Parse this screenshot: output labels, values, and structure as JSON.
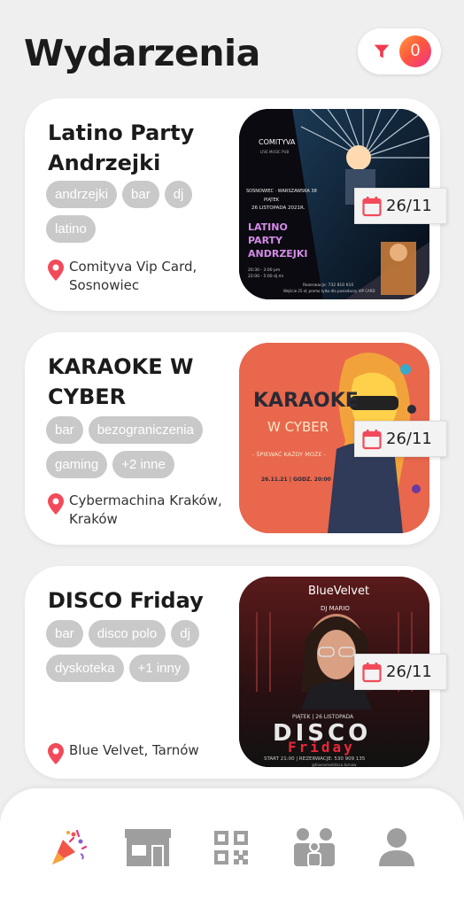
{
  "header": {
    "title": "Wydarzenia",
    "filter_icon": "filter-icon",
    "filter_count": "0"
  },
  "colors": {
    "accent": "#f24a5a",
    "tag_bg": "#c9c9c9",
    "nav_inactive": "#9e9e9e",
    "background": "#efefef"
  },
  "events": [
    {
      "title": "Latino Party Andrzejki",
      "tags": [
        "andrzejki",
        "bar",
        "dj",
        "latino"
      ],
      "location": "Comityva Vip Card, Sosnowiec",
      "date": "26/11",
      "poster": {
        "brand": "COMITYVA",
        "subbrand": "LIVE MUSIC PUB",
        "address": "SOSNOWIEC · WARSZAWSKA 38",
        "day": "PIĄTEK",
        "date_line": "26 LISTOPADA 2021R.",
        "title_lines": [
          "LATINO",
          "PARTY",
          "ANDRZEJKI"
        ],
        "time1": "20:30 - 3:00 pm",
        "time2": "22:00 - 5:00 dj mi",
        "footer1": "Rezerwacje: 732 810 610",
        "footer2": "Wejście 25 zł, promo tylko dla posiadaczy VIP CARD"
      }
    },
    {
      "title": "KARAOKE W CYBER",
      "tags": [
        "bar",
        "bezograniczenia",
        "gaming",
        "+2 inne"
      ],
      "location": "Cybermachina Kraków, Kraków",
      "date": "26/11",
      "poster": {
        "title": "KARAOKE",
        "subtitle": "W CYBER",
        "tagline": "- ŚPIEWAĆ KAŻDY MOŻE -",
        "when": "26.11.21 | GODZ. 20:00"
      }
    },
    {
      "title": "DISCO Friday",
      "tags": [
        "bar",
        "disco polo",
        "dj",
        "dyskoteka",
        "+1 inny"
      ],
      "location": "Blue Velvet, Tarnów",
      "date": "26/11",
      "poster": {
        "brand": "BlueVelvet",
        "dj": "DJ MARIO",
        "date_line": "PIĄTEK | 26 LISTOPADA",
        "word1": "DISCO",
        "word2": "Friday",
        "footer": "START 21:00 | REZERWACJE: 530 909 135",
        "social": "@bluevelvetdisco.tarnow"
      }
    }
  ],
  "nav": [
    {
      "icon": "party-popper-icon",
      "active": true
    },
    {
      "icon": "store-icon",
      "active": false
    },
    {
      "icon": "qr-code-icon",
      "active": false
    },
    {
      "icon": "group-icon",
      "active": false
    },
    {
      "icon": "user-icon",
      "active": false
    }
  ]
}
